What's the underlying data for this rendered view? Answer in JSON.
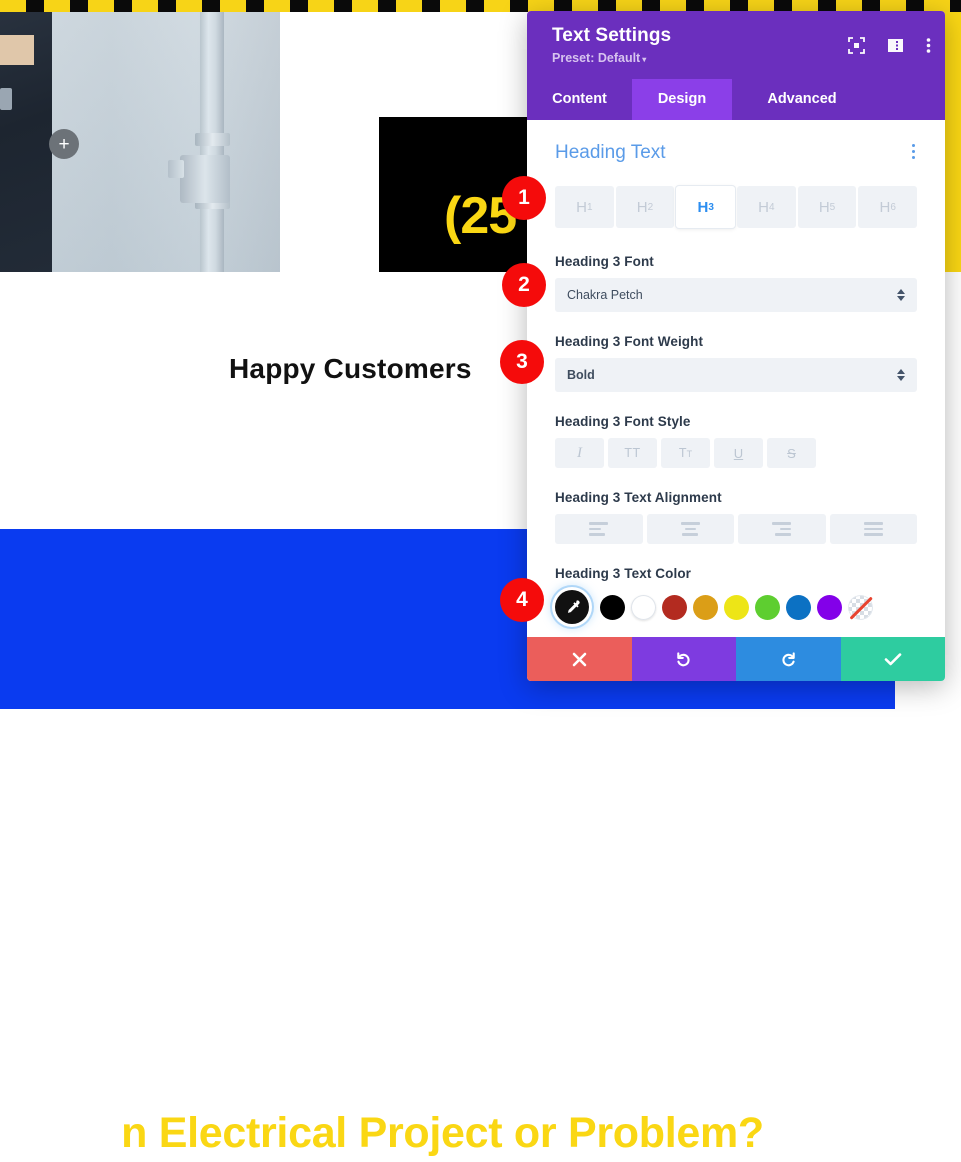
{
  "background": {
    "add_module_icon": "plus-icon",
    "hero_headline": "(25",
    "section_heading": "Happy Customers",
    "cta_heading": "n Electrical Project or Problem?"
  },
  "modal": {
    "title": "Text Settings",
    "preset_label": "Preset: Default",
    "preset_caret": "▾",
    "header_icons": [
      "fullscreen-icon",
      "panel-layout-icon",
      "more-options-icon"
    ],
    "tabs": [
      {
        "label": "Content",
        "active": false
      },
      {
        "label": "Design",
        "active": true
      },
      {
        "label": "Advanced",
        "active": false
      }
    ],
    "section": {
      "title": "Heading Text",
      "menu_icon": "kebab-menu-icon"
    },
    "heading_levels": [
      {
        "label": "H",
        "sub": "1",
        "active": false
      },
      {
        "label": "H",
        "sub": "2",
        "active": false
      },
      {
        "label": "H",
        "sub": "3",
        "active": true
      },
      {
        "label": "H",
        "sub": "4",
        "active": false
      },
      {
        "label": "H",
        "sub": "5",
        "active": false
      },
      {
        "label": "H",
        "sub": "6",
        "active": false
      }
    ],
    "font": {
      "label": "Heading 3 Font",
      "value": "Chakra Petch"
    },
    "font_weight": {
      "label": "Heading 3 Font Weight",
      "value": "Bold"
    },
    "font_style": {
      "label": "Heading 3 Font Style",
      "buttons": [
        {
          "name": "italic-icon",
          "glyph": "I"
        },
        {
          "name": "uppercase-icon",
          "glyph": "TT"
        },
        {
          "name": "smallcaps-icon",
          "glyph": "T"
        },
        {
          "name": "underline-icon",
          "glyph": "U"
        },
        {
          "name": "strikethrough-icon",
          "glyph": "S"
        }
      ]
    },
    "text_alignment": {
      "label": "Heading 3 Text Alignment",
      "buttons": [
        "align-left-icon",
        "align-center-icon",
        "align-right-icon",
        "align-justify-icon"
      ]
    },
    "text_color": {
      "label": "Heading 3 Text Color",
      "eyedropper": {
        "name": "eyedropper-icon",
        "selected": true
      },
      "swatches": [
        {
          "name": "color-black",
          "hex": "#000000"
        },
        {
          "name": "color-white",
          "hex": "#FFFFFF"
        },
        {
          "name": "color-dark-red",
          "hex": "#B32B20"
        },
        {
          "name": "color-amber",
          "hex": "#DB9E17"
        },
        {
          "name": "color-yellow",
          "hex": "#EDE517"
        },
        {
          "name": "color-green",
          "hex": "#5ECE30"
        },
        {
          "name": "color-blue",
          "hex": "#0C71C3"
        },
        {
          "name": "color-purple",
          "hex": "#8300E9"
        },
        {
          "name": "color-transparent",
          "hex": "transparent"
        }
      ]
    },
    "footer": [
      {
        "name": "cancel-button",
        "glyph": "✕",
        "color": "#EB5E5B"
      },
      {
        "name": "undo-button",
        "glyph": "↺",
        "color": "#7E3BE0"
      },
      {
        "name": "redo-button",
        "glyph": "↻",
        "color": "#2D8CE0"
      },
      {
        "name": "save-button",
        "glyph": "✓",
        "color": "#2ECCA0"
      }
    ]
  },
  "badges": [
    {
      "number": "1"
    },
    {
      "number": "2"
    },
    {
      "number": "3"
    },
    {
      "number": "4"
    }
  ],
  "colors": {
    "modal_header": "#6B2FBE",
    "tab_active": "#8B3FE8",
    "section_title": "#5A9BE8",
    "accent_yellow": "#FAD714",
    "accent_blue": "#0A3BF0",
    "badge_red": "#F50B0B"
  }
}
